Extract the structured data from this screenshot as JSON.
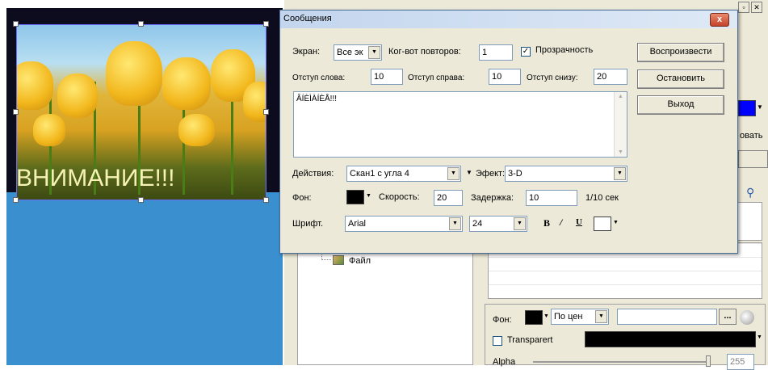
{
  "stage": {
    "caption": "ВНИМАНИЕ!!!"
  },
  "dialog": {
    "title": "Сообщения",
    "close_glyph": "x",
    "row1": {
      "screen_label": "Экран:",
      "screen_value": "Все эк",
      "repeat_label": "Ког-вот повторов:",
      "repeat_value": "1",
      "transparency_label": "Прозрачность",
      "transparency_checked": true
    },
    "row2": {
      "indent_word_label": "Отступ слова:",
      "indent_word_value": "10",
      "indent_right_label": "Отступ справа:",
      "indent_right_value": "10",
      "indent_bottom_label": "Отступ снизу:",
      "indent_bottom_value": "20"
    },
    "message_text": "ÂÍÈÌÀÍÈÅ!!!",
    "actions_label": "Действия:",
    "actions_value": "Скан1 с угла 4",
    "effect_label": "Эфект:",
    "effect_value": "3-D",
    "bg_label": "Фон:",
    "bg_color": "#000000",
    "speed_label": "Скорость:",
    "speed_value": "20",
    "delay_label": "Задержка:",
    "delay_value": "10",
    "delay_unit": "1/10 сек",
    "font_label": "Шрифт.",
    "font_value": "Arial",
    "size_value": "24",
    "bold_glyph": "B",
    "italic_glyph": "/",
    "underline_glyph": "U",
    "buttons": {
      "play": "Воспроизвести",
      "stop": "Остановить",
      "exit": "Выход"
    }
  },
  "background_app": {
    "tree_item": "Файл",
    "partial_label": "овать",
    "bg_label": "Фон:",
    "align_value": "По цен",
    "more_glyph": "...",
    "transparent_label": "Transparert",
    "alpha_label": "Alpha",
    "alpha_value": "255",
    "accent_color": "#0000ff"
  }
}
